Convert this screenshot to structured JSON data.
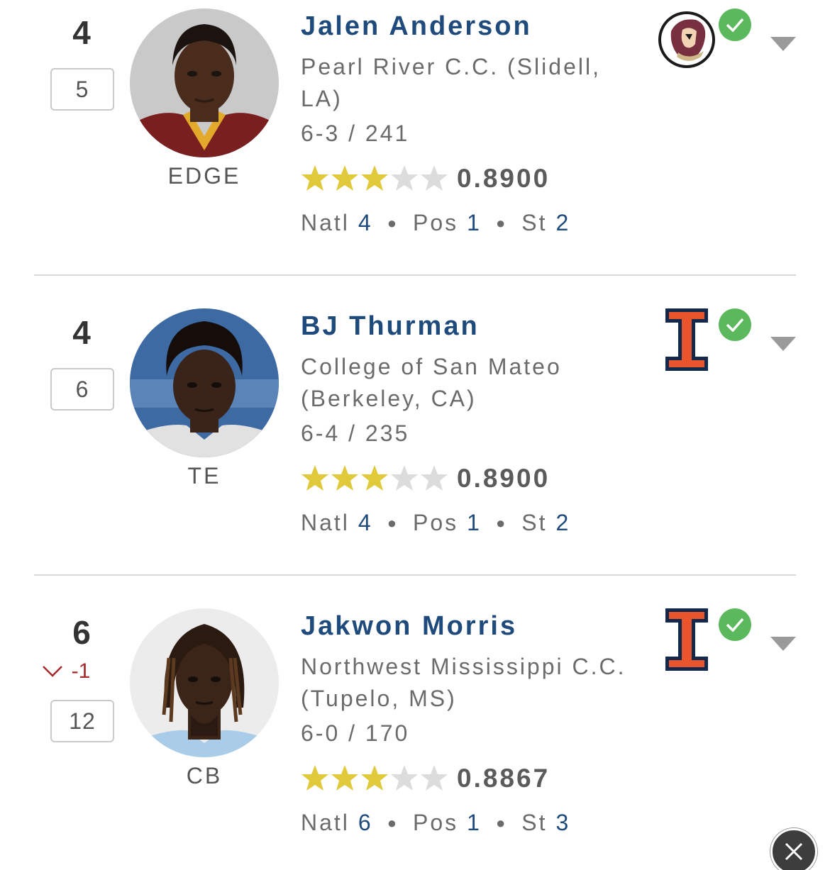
{
  "players": [
    {
      "rank": "4",
      "change": "",
      "prev_rank": "5",
      "position": "EDGE",
      "name": "Jalen Anderson",
      "school": "Pearl River C.C. (Slidell, LA)",
      "measurements": "6-3 / 241",
      "stars": 3,
      "rating": "0.8900",
      "natl_label": "Natl",
      "natl": "4",
      "pos_label": "Pos",
      "pos": "1",
      "st_label": "St",
      "st": "2",
      "commit_logo": "florida-state-seminoles-logo",
      "committed": true,
      "jersey_color": "#7a1f1f"
    },
    {
      "rank": "4",
      "change": "",
      "prev_rank": "6",
      "position": "TE",
      "name": "BJ Thurman",
      "school": "College of San Mateo (Berkeley, CA)",
      "measurements": "6-4 / 235",
      "stars": 3,
      "rating": "0.8900",
      "natl_label": "Natl",
      "natl": "4",
      "pos_label": "Pos",
      "pos": "1",
      "st_label": "St",
      "st": "2",
      "commit_logo": "illinois-block-i-logo",
      "committed": true,
      "jersey_color": "#d9d9d9"
    },
    {
      "rank": "6",
      "change": "-1",
      "prev_rank": "12",
      "position": "CB",
      "name": "Jakwon Morris",
      "school": "Northwest Mississippi C.C. (Tupelo, MS)",
      "measurements": "6-0 / 170",
      "stars": 3,
      "rating": "0.8867",
      "natl_label": "Natl",
      "natl": "6",
      "pos_label": "Pos",
      "pos": "1",
      "st_label": "St",
      "st": "3",
      "commit_logo": "illinois-block-i-logo",
      "committed": true,
      "jersey_color": "#a9cde8"
    }
  ],
  "colors": {
    "name": "#1f4a7c",
    "star_filled": "#e0c93a",
    "star_empty": "#dcdcdc",
    "check": "#5cb85c",
    "illinois_orange": "#e8542b",
    "illinois_navy": "#13294b",
    "drop_arrow": "#a32a2a"
  },
  "icons": {
    "check": "checkmark-circle-icon",
    "caret": "caret-down-icon",
    "change": "chevron-down-icon",
    "close": "close-icon"
  }
}
